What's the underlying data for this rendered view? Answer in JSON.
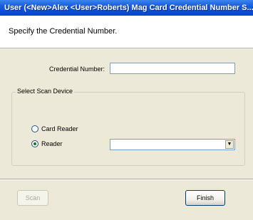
{
  "window": {
    "title": "User (<New>Alex <User>Roberts) Mag Card Credential Number S..."
  },
  "header": {
    "instruction": "Specify the Credential Number."
  },
  "form": {
    "credential_label": "Credential Number:",
    "credential_value": ""
  },
  "scan_device": {
    "group_label": "Select Scan Device",
    "options": [
      {
        "label": "Card Reader",
        "checked": false
      },
      {
        "label": "Reader",
        "checked": true
      }
    ],
    "reader_selected": ""
  },
  "buttons": {
    "scan_label": "Scan",
    "finish_label": "Finish"
  },
  "icons": {
    "dropdown_arrow": "chevron-down-icon"
  }
}
